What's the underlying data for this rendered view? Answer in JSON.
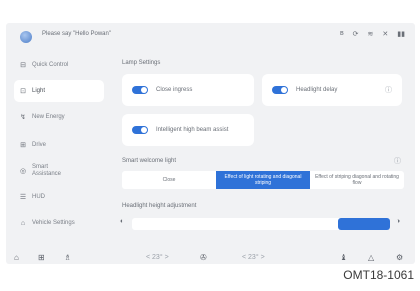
{
  "header": {
    "greeting": "Please say \"Hello Powan\""
  },
  "sidebar": {
    "items": [
      {
        "label": "Quick Control",
        "icon": "quick-control-icon"
      },
      {
        "label": "Light",
        "icon": "light-icon"
      },
      {
        "label": "New Energy",
        "icon": "new-energy-icon"
      },
      {
        "label": "Drive",
        "icon": "drive-icon"
      },
      {
        "label": "Smart Assistance",
        "icon": "smart-assistance-icon"
      },
      {
        "label": "HUD",
        "icon": "hud-icon"
      },
      {
        "label": "Vehicle Settings",
        "icon": "vehicle-settings-icon"
      }
    ],
    "active_index": 1
  },
  "lamp_settings": {
    "title": "Lamp Settings",
    "close_ingress": "Close ingress",
    "headlight_delay": "Headlight delay",
    "high_beam_assist": "Intelligent high beam assist"
  },
  "welcome": {
    "title": "Smart welcome light",
    "options": [
      "Close",
      "Effect of light rotating and diagonal striping",
      "Effect of striping diagonal and rotating flow"
    ],
    "selected_index": 1
  },
  "headlight": {
    "title": "Headlight height adjustment",
    "level_fraction": 0.2
  },
  "bottom": {
    "temp_left": "< 23° >",
    "temp_right": "< 23° >"
  },
  "code": "OMT18-1061",
  "colors": {
    "accent": "#2f72d8"
  }
}
